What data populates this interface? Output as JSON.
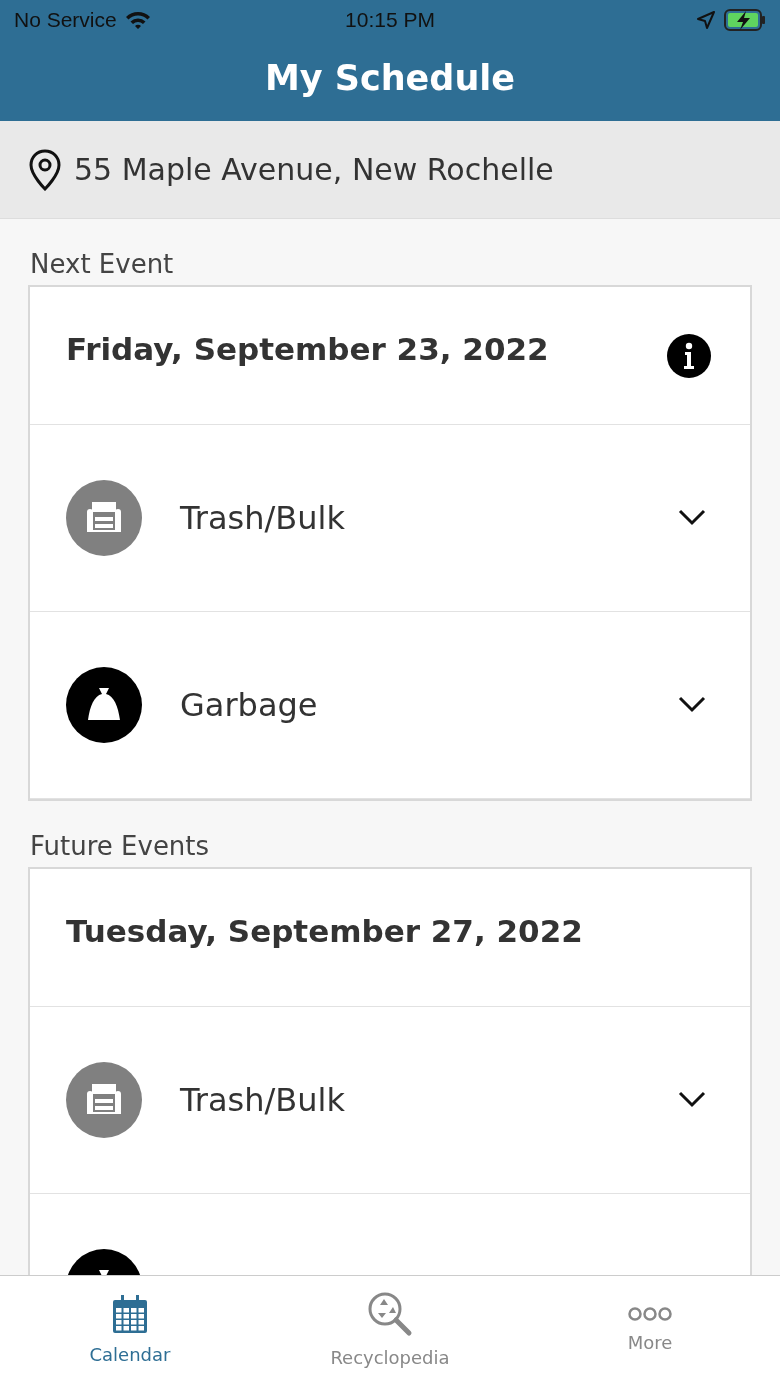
{
  "status_bar": {
    "carrier": "No Service",
    "time": "10:15 PM"
  },
  "header": {
    "title": "My Schedule"
  },
  "address": {
    "text": "55 Maple Avenue, New Rochelle"
  },
  "sections": [
    {
      "heading": "Next Event",
      "date": "Friday, September 23, 2022",
      "info_button": true,
      "items": [
        {
          "kind": "bulk",
          "label": "Trash/Bulk",
          "expanded": false
        },
        {
          "kind": "garbage",
          "label": "Garbage",
          "expanded": false
        }
      ]
    },
    {
      "heading": "Future Events",
      "date": "Tuesday, September 27, 2022",
      "info_button": false,
      "items": [
        {
          "kind": "bulk",
          "label": "Trash/Bulk",
          "expanded": false
        },
        {
          "kind": "garbage"
        }
      ]
    }
  ],
  "tabs": [
    {
      "kind": "calendar",
      "label": "Calendar",
      "selected": true
    },
    {
      "kind": "search",
      "label": "Recyclopedia",
      "selected": false
    },
    {
      "kind": "more",
      "label": "More",
      "selected": false
    }
  ]
}
